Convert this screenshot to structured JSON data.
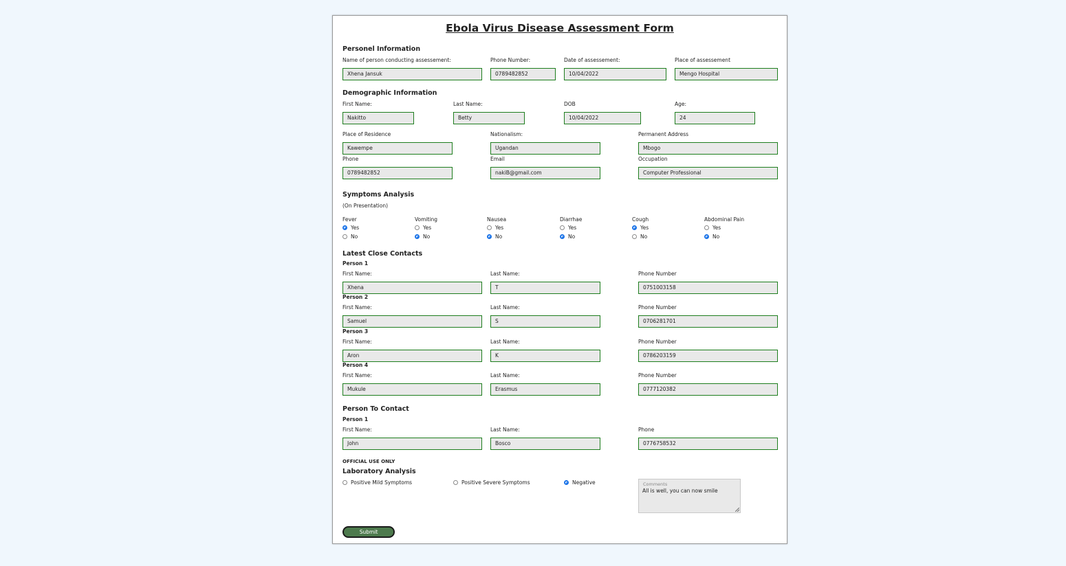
{
  "form": {
    "title": "Ebola Virus Disease Assessment Form",
    "personnel": {
      "heading": "Personel Information",
      "name_label": "Name of person conducting assessement:",
      "name_value": "Xhena Jansuk",
      "phone_label": "Phone Number:",
      "phone_value": "0789482852",
      "date_label": "Date of assessement:",
      "date_value": "10/04/2022",
      "place_label": "Place of assessement",
      "place_value": "Mengo Hospital"
    },
    "demographic": {
      "heading": "Demographic Information",
      "first_name_label": "First Name:",
      "first_name_value": "Nakitto",
      "last_name_label": "Last Name:",
      "last_name_value": "Betty",
      "dob_label": "DOB",
      "dob_value": "10/04/2022",
      "age_label": "Age:",
      "age_value": "24",
      "residence_label": "Place of Residence",
      "residence_value": "Kawempe",
      "nationalism_label": "Nationalism:",
      "nationalism_value": "Ugandan",
      "address_label": "Permanent Address",
      "address_value": "Mbogo",
      "phone_label": "Phone",
      "phone_value": "0789482852",
      "email_label": "Email",
      "email_value": "nakiB@gmail.com",
      "occupation_label": "Occupation",
      "occupation_value": "Computer Professional"
    },
    "symptoms": {
      "heading": "Symptoms Analysis",
      "subheading": "(On Presentation)",
      "yes_label": "Yes",
      "no_label": "No",
      "items": [
        {
          "name": "Fever",
          "selected": "Yes"
        },
        {
          "name": "Vomiting",
          "selected": "No"
        },
        {
          "name": "Nausea",
          "selected": "No"
        },
        {
          "name": "Diarrhae",
          "selected": "No"
        },
        {
          "name": "Cough",
          "selected": "Yes"
        },
        {
          "name": "Abdominal Pain",
          "selected": "No"
        }
      ]
    },
    "contacts": {
      "heading": "Latest Close Contacts",
      "first_name_label": "First Name:",
      "last_name_label": "Last Name:",
      "phone_label": "Phone Number",
      "people": [
        {
          "label": "Person 1",
          "first": "Xhena",
          "last": "T",
          "phone": "0751003158"
        },
        {
          "label": "Person 2",
          "first": "Samuel",
          "last": "S",
          "phone": "0706281701"
        },
        {
          "label": "Person 3",
          "first": "Aron",
          "last": "K",
          "phone": "0786203159"
        },
        {
          "label": "Person 4",
          "first": "Mukule",
          "last": "Erasmus",
          "phone": "0777120382"
        }
      ]
    },
    "person_to_contact": {
      "heading": "Person To Contact",
      "person_label": "Person 1",
      "first_name_label": "First Name:",
      "first_name_value": "John",
      "last_name_label": "Last Name:",
      "last_name_value": "Bosco",
      "phone_label": "Phone",
      "phone_value": "0776758532"
    },
    "official": {
      "label": "OFFICIAL USE ONLY",
      "heading": "Laboratory Analysis",
      "options": [
        "Positive Mild Symptoms",
        "Positive Severe Symptoms",
        "Negative"
      ],
      "selected": "Negative",
      "comments_placeholder": "Comments",
      "comments_value": "All is well, you can now smile"
    },
    "submit_label": "Submit"
  },
  "colors": {
    "page_background": "#f0f7fd",
    "input_border": "#1d7d1d",
    "input_background": "#e9e9e9",
    "radio_selected": "#1a73e8",
    "submit_background": "#4d7a4d"
  }
}
